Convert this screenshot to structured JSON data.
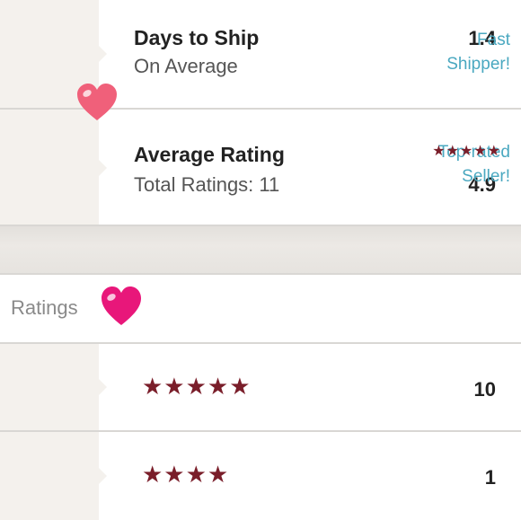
{
  "shipping": {
    "value": "1.4",
    "title": "Days to Ship",
    "subtitle": "On Average",
    "badge_line1": "Fast",
    "badge_line2": "Shipper!"
  },
  "rating": {
    "stars": "★★★★★",
    "value": "4.9",
    "title": "Average Rating",
    "subtitle": "Total Ratings: 11",
    "badge_line1": "Top-rated",
    "badge_line2": "Seller!"
  },
  "ratings_section": {
    "label": "Ratings",
    "rows": [
      {
        "count": "10",
        "stars": "★★★★★",
        "star_count": 5
      },
      {
        "count": "1",
        "stars": "★★★★",
        "star_count": 4
      }
    ]
  },
  "colors": {
    "star": "#7a1e2a",
    "badge": "#4aa8c0",
    "heart_light": "#f0607a",
    "heart_pink": "#e8177a"
  },
  "icons": [
    "heart-icon",
    "star-icon"
  ]
}
